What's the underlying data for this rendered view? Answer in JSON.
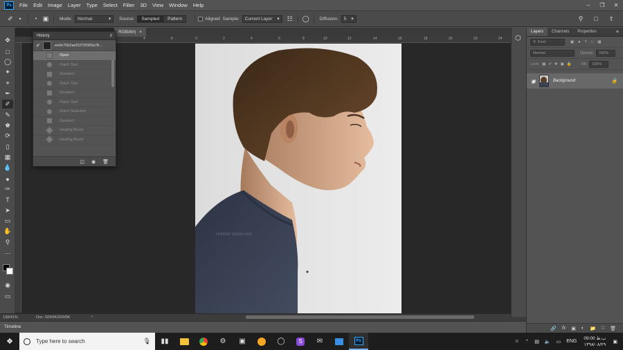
{
  "menu": [
    "File",
    "Edit",
    "Image",
    "Layer",
    "Type",
    "Select",
    "Filter",
    "3D",
    "View",
    "Window",
    "Help"
  ],
  "app_logo": "Ps",
  "options_bar": {
    "mode_label": "Mode:",
    "mode_value": "Normal",
    "source_label": "Source:",
    "source_sampled": "Sampled",
    "source_pattern": "Pattern",
    "aligned_label": "Aligned",
    "sample_label": "Sample:",
    "sample_value": "Current Layer",
    "diffusion_label": "Diffusion:",
    "diffusion_value": "5"
  },
  "document": {
    "tab_title": "RGB/8#)",
    "ruler_ticks": [
      "4",
      "6",
      "0",
      "2",
      "4",
      "6",
      "8",
      "10",
      "12",
      "14",
      "16",
      "18",
      "20",
      "22",
      "24"
    ],
    "watermark": "Hotshot Studio.com"
  },
  "status": {
    "zoom": "138/41%",
    "doc_info": "Doc: 929/9K/929/9K"
  },
  "timeline_label": "Timeline",
  "history": {
    "title": "History",
    "snapshot_name": "ee0e70b2ae91f7209f3a78...",
    "items": [
      {
        "label": "Open",
        "selected": true
      },
      {
        "label": "Patch Tool",
        "selected": false
      },
      {
        "label": "Deselect",
        "selected": false
      },
      {
        "label": "Patch Tool",
        "selected": false
      },
      {
        "label": "Deselect",
        "selected": false
      },
      {
        "label": "Patch Tool",
        "selected": false
      },
      {
        "label": "Patch Selection",
        "selected": false
      },
      {
        "label": "Deselect",
        "selected": false
      },
      {
        "label": "Healing Brush",
        "selected": false
      },
      {
        "label": "Healing Brush",
        "selected": false
      }
    ]
  },
  "layers_panel": {
    "tabs": [
      "Layers",
      "Channels",
      "Properties"
    ],
    "kind_label": "Kind",
    "blend_mode": "Normal",
    "opacity_label": "Opacity:",
    "opacity_value": "100%",
    "lock_label": "Lock:",
    "fill_label": "Fill:",
    "fill_value": "100%",
    "layer_name": "Background"
  },
  "taskbar": {
    "search_placeholder": "Type here to search",
    "language": "ENG",
    "time": "09:00 ب.ظ",
    "date": "۱۳۹۸/۰۸/۲۹"
  },
  "colors": {
    "ps_blue": "#31a8ff",
    "panel_bg": "#535353",
    "canvas_bg": "#282828",
    "taskbar_bg": "#1d1d1d"
  }
}
